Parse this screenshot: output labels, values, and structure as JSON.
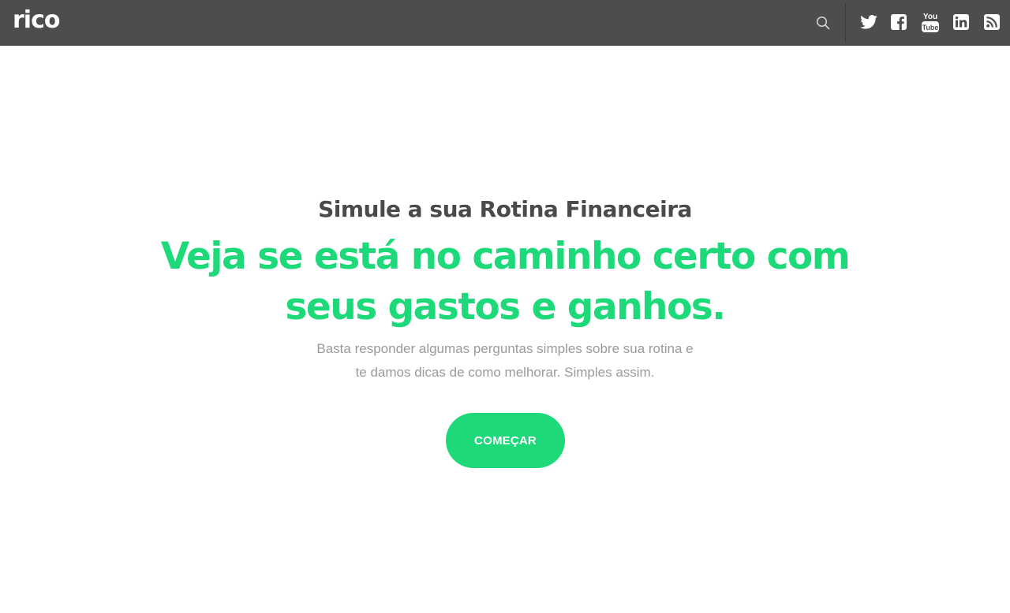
{
  "header": {
    "logo_text": "rico",
    "search_icon": "search-icon",
    "social": [
      {
        "name": "twitter-icon"
      },
      {
        "name": "facebook-icon"
      },
      {
        "name": "youtube-icon",
        "label": "You Tube"
      },
      {
        "name": "linkedin-icon"
      },
      {
        "name": "rss-icon"
      }
    ]
  },
  "hero": {
    "subtitle": "Simule a sua Rotina Financeira",
    "headline": "Veja se está no caminho certo com seus gastos e ganhos.",
    "description_line1": "Basta responder algumas perguntas simples sobre sua rotina e",
    "description_line2": "te damos dicas de como melhorar. Simples assim.",
    "cta_label": "COMEÇAR"
  },
  "colors": {
    "topbar": "#4d4d4d",
    "accent": "#1ed97a",
    "subtitle": "#4a4a4a",
    "description": "#9a9a9a"
  }
}
